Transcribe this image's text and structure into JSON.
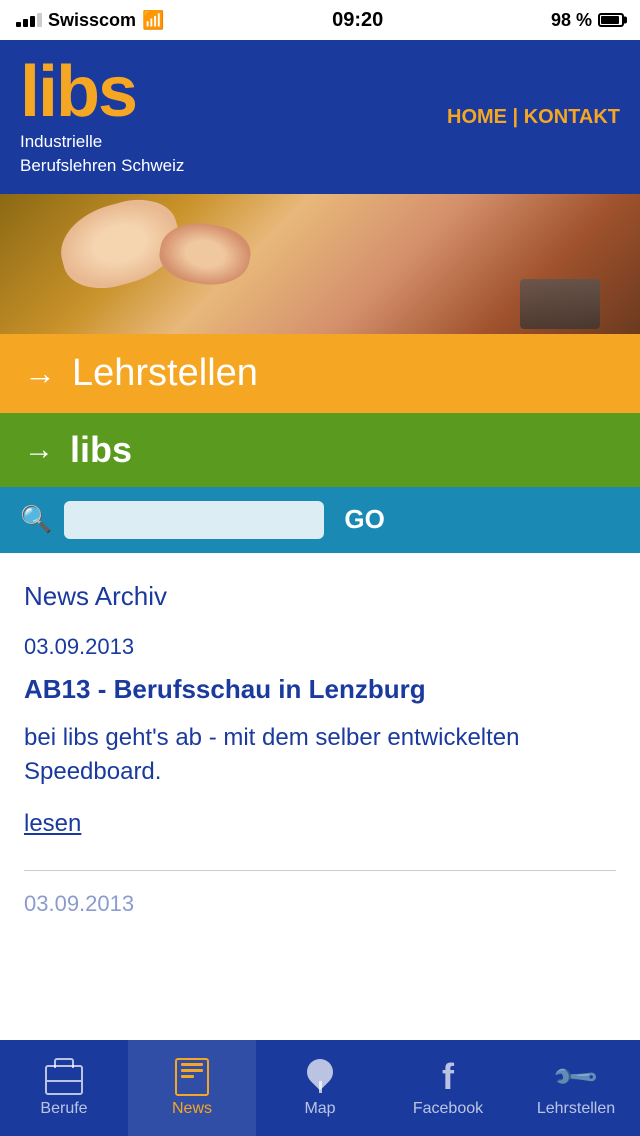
{
  "statusBar": {
    "carrier": "Swisscom",
    "time": "09:20",
    "battery": "98 %"
  },
  "header": {
    "logoText": "libs",
    "subtitle1": "Industrielle",
    "subtitle2": "Berufslehren Schweiz",
    "navHome": "HOME",
    "navSeparator": " | ",
    "navKontakt": "KONTAKT"
  },
  "menu": {
    "lehrstellen": "Lehrstellen",
    "libs": "libs"
  },
  "search": {
    "placeholder": "",
    "goLabel": "GO"
  },
  "content": {
    "pageTitle": "News Archiv",
    "articles": [
      {
        "date": "03.09.2013",
        "headline": "AB13 - Berufsschau in Lenzburg",
        "body": "bei libs geht's ab - mit dem selber entwickelten Speedboard.",
        "readLink": "lesen"
      }
    ],
    "partialDate": "03.09.2013"
  },
  "tabBar": {
    "tabs": [
      {
        "id": "berufe",
        "label": "Berufe",
        "active": false
      },
      {
        "id": "news",
        "label": "News",
        "active": true
      },
      {
        "id": "map",
        "label": "Map",
        "active": false
      },
      {
        "id": "facebook",
        "label": "Facebook",
        "active": false
      },
      {
        "id": "lehrstellen",
        "label": "Lehrstellen",
        "active": false
      }
    ]
  },
  "colors": {
    "blue": "#1a3a9e",
    "orange": "#f5a623",
    "green": "#5a9a1e",
    "teal": "#1a8ab5"
  }
}
